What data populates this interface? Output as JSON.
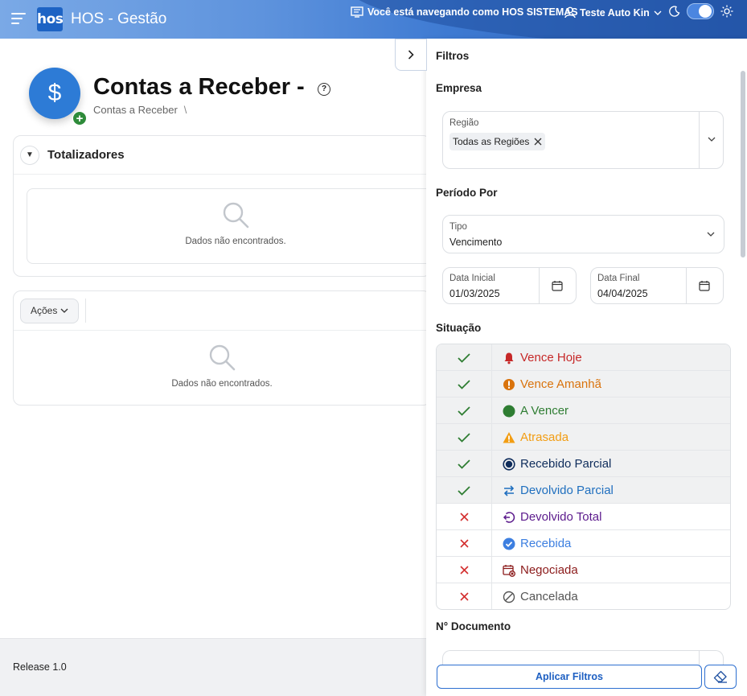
{
  "header": {
    "logo_text": "hos",
    "app_title": "HOS - Gestão",
    "browsing_text": "Você está navegando como HOS SISTEMAS",
    "user_name": "Teste Auto Kin"
  },
  "page": {
    "title": "Contas a Receber -",
    "breadcrumb": "Contas a Receber",
    "breadcrumb_sep": "\\"
  },
  "totalizers": {
    "title": "Totalizadores",
    "empty_text": "Dados não encontrados."
  },
  "actions": {
    "button_label": "Ações",
    "empty_text": "Dados não encontrados."
  },
  "footer": {
    "release": "Release 1.0"
  },
  "filters": {
    "title": "Filtros",
    "empresa_label": "Empresa",
    "regiao": {
      "label": "Região",
      "chip": "Todas as Regiões"
    },
    "periodo_label": "Período Por",
    "tipo": {
      "label": "Tipo",
      "value": "Vencimento"
    },
    "data_inicial": {
      "label": "Data Inicial",
      "value": "01/03/2025"
    },
    "data_final": {
      "label": "Data Final",
      "value": "04/04/2025"
    },
    "situacao_label": "Situação",
    "situacoes": [
      {
        "label": "Vence Hoje",
        "checked": true,
        "color": "#c62828",
        "icon": "bell-icon"
      },
      {
        "label": "Vence Amanhã",
        "checked": true,
        "color": "#d9730d",
        "icon": "alert-circle-icon"
      },
      {
        "label": "A Vencer",
        "checked": true,
        "color": "#2e7d32",
        "icon": "dot-icon"
      },
      {
        "label": "Atrasada",
        "checked": true,
        "color": "#f29d13",
        "icon": "warning-icon"
      },
      {
        "label": "Recebido Parcial",
        "checked": true,
        "color": "#0f2d5c",
        "icon": "radio-icon"
      },
      {
        "label": "Devolvido Parcial",
        "checked": true,
        "color": "#1f6fbf",
        "icon": "swap-icon"
      },
      {
        "label": "Devolvido Total",
        "checked": false,
        "color": "#5b1a8c",
        "icon": "return-icon"
      },
      {
        "label": "Recebida",
        "checked": false,
        "color": "#3d7fe0",
        "icon": "check-circle-icon"
      },
      {
        "label": "Negociada",
        "checked": false,
        "color": "#8b1a1a",
        "icon": "calendar-x-icon"
      },
      {
        "label": "Cancelada",
        "checked": false,
        "color": "#555555",
        "icon": "cancel-icon"
      }
    ],
    "documento_label": "N° Documento",
    "apply_label": "Aplicar Filtros"
  }
}
